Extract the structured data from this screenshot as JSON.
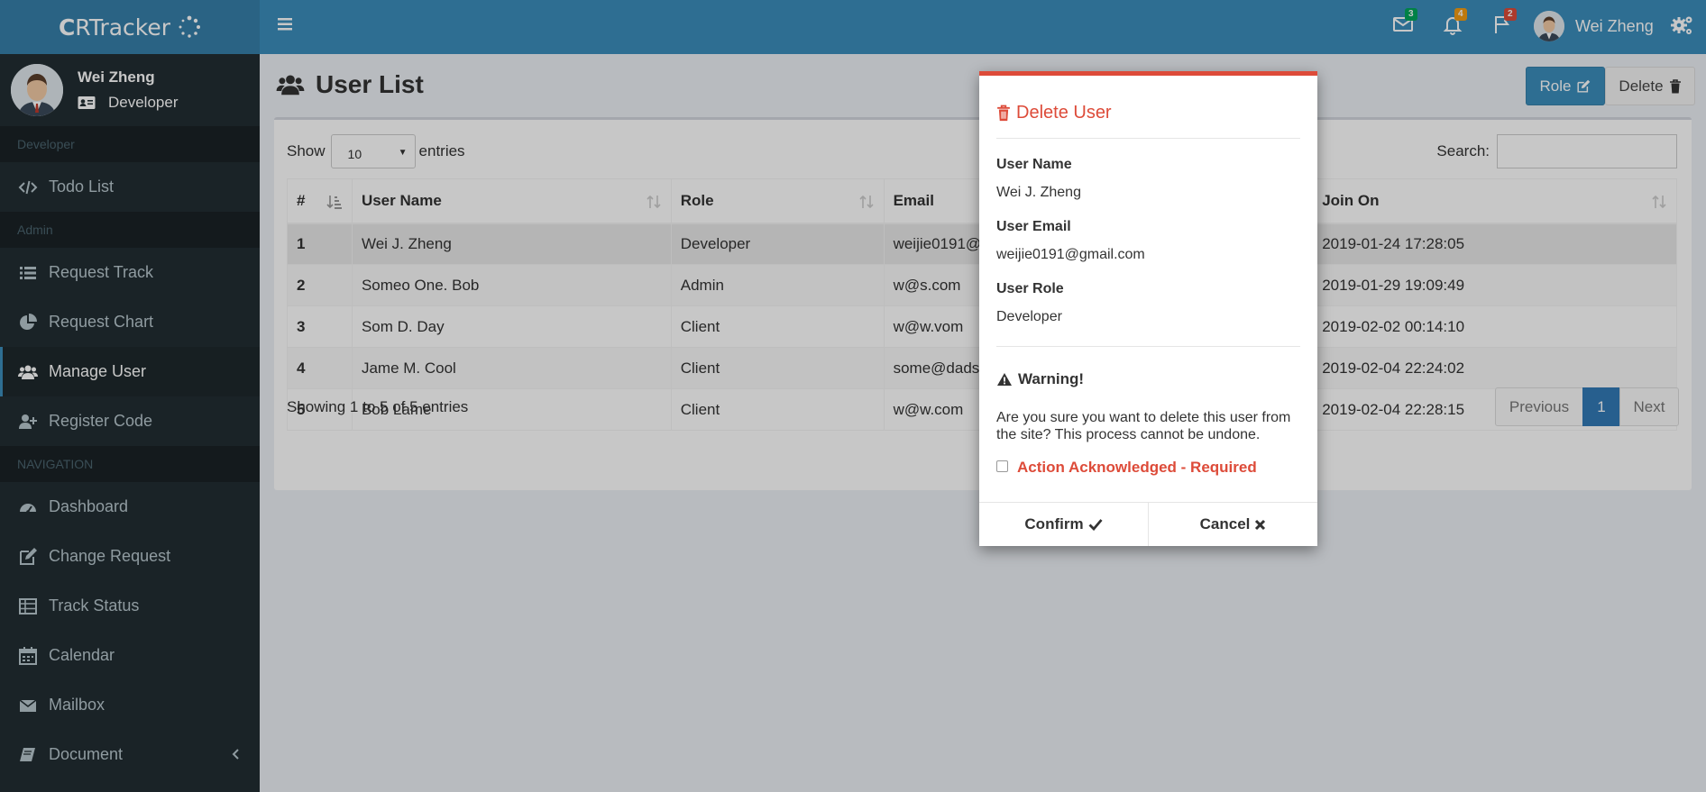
{
  "app": {
    "logo": "CRTracker"
  },
  "user": {
    "name": "Wei Zheng",
    "role": "Developer"
  },
  "sidebar": {
    "sections": [
      {
        "header": "Developer",
        "items": [
          {
            "label": "Todo List",
            "icon": "code-icon"
          }
        ]
      },
      {
        "header": "Admin",
        "items": [
          {
            "label": "Request Track",
            "icon": "list-icon"
          },
          {
            "label": "Request Chart",
            "icon": "pie-chart-icon"
          },
          {
            "label": "Manage User",
            "icon": "users-icon",
            "active": true
          },
          {
            "label": "Register Code",
            "icon": "user-plus-icon"
          }
        ]
      },
      {
        "header": "NAVIGATION",
        "items": [
          {
            "label": "Dashboard",
            "icon": "dashboard-icon"
          },
          {
            "label": "Change Request",
            "icon": "edit-icon"
          },
          {
            "label": "Track Status",
            "icon": "table-icon"
          },
          {
            "label": "Calendar",
            "icon": "calendar-icon"
          },
          {
            "label": "Mailbox",
            "icon": "envelope-icon"
          },
          {
            "label": "Document",
            "icon": "book-icon"
          }
        ]
      }
    ]
  },
  "topbar": {
    "badges": {
      "messages": "3",
      "notifications": "4",
      "flags": "2"
    },
    "badge_colors": {
      "messages": "#00a65a",
      "notifications": "#f39c12",
      "flags": "#dd4b39"
    }
  },
  "page": {
    "title": "User List",
    "buttons": {
      "role": "Role",
      "delete": "Delete"
    },
    "show_label": "Show",
    "page_size": "10",
    "entries_label": "entries",
    "search_label": "Search:",
    "search_value": "",
    "columns": [
      "#",
      "User Name",
      "Role",
      "Email",
      "",
      "Join On"
    ],
    "rows": [
      {
        "num": "1",
        "name": "Wei J. Zheng",
        "role": "Developer",
        "email": "weijie0191@",
        "join": "2019-01-24 17:28:05"
      },
      {
        "num": "2",
        "name": "Someo One. Bob",
        "role": "Admin",
        "email": "w@s.com",
        "join": "2019-01-29 19:09:49"
      },
      {
        "num": "3",
        "name": "Som D. Day",
        "role": "Client",
        "email": "w@w.vom",
        "join": "2019-02-02 00:14:10"
      },
      {
        "num": "4",
        "name": "Jame M. Cool",
        "role": "Client",
        "email": "some@dads",
        "join": "2019-02-04 22:24:02"
      },
      {
        "num": "5",
        "name": "Bob Lame",
        "role": "Client",
        "email": "w@w.com",
        "join": "2019-02-04 22:28:15"
      }
    ],
    "info": "Showing 1 to 5 of 5 entries",
    "pager": {
      "prev": "Previous",
      "current": "1",
      "next": "Next"
    }
  },
  "modal": {
    "title": "Delete User",
    "username_label": "User Name",
    "username": "Wei J. Zheng",
    "email_label": "User Email",
    "email": "weijie0191@gmail.com",
    "role_label": "User Role",
    "role": "Developer",
    "warning_title": "Warning!",
    "warning_text": "Are you sure you want to delete this user from the site? This process cannot be undone.",
    "ack_label": "Action Acknowledged - Required",
    "confirm": "Confirm",
    "cancel": "Cancel"
  },
  "colors": {
    "accent": "#3c8dbc",
    "danger": "#dd4b39",
    "sidebar": "#222d32"
  }
}
